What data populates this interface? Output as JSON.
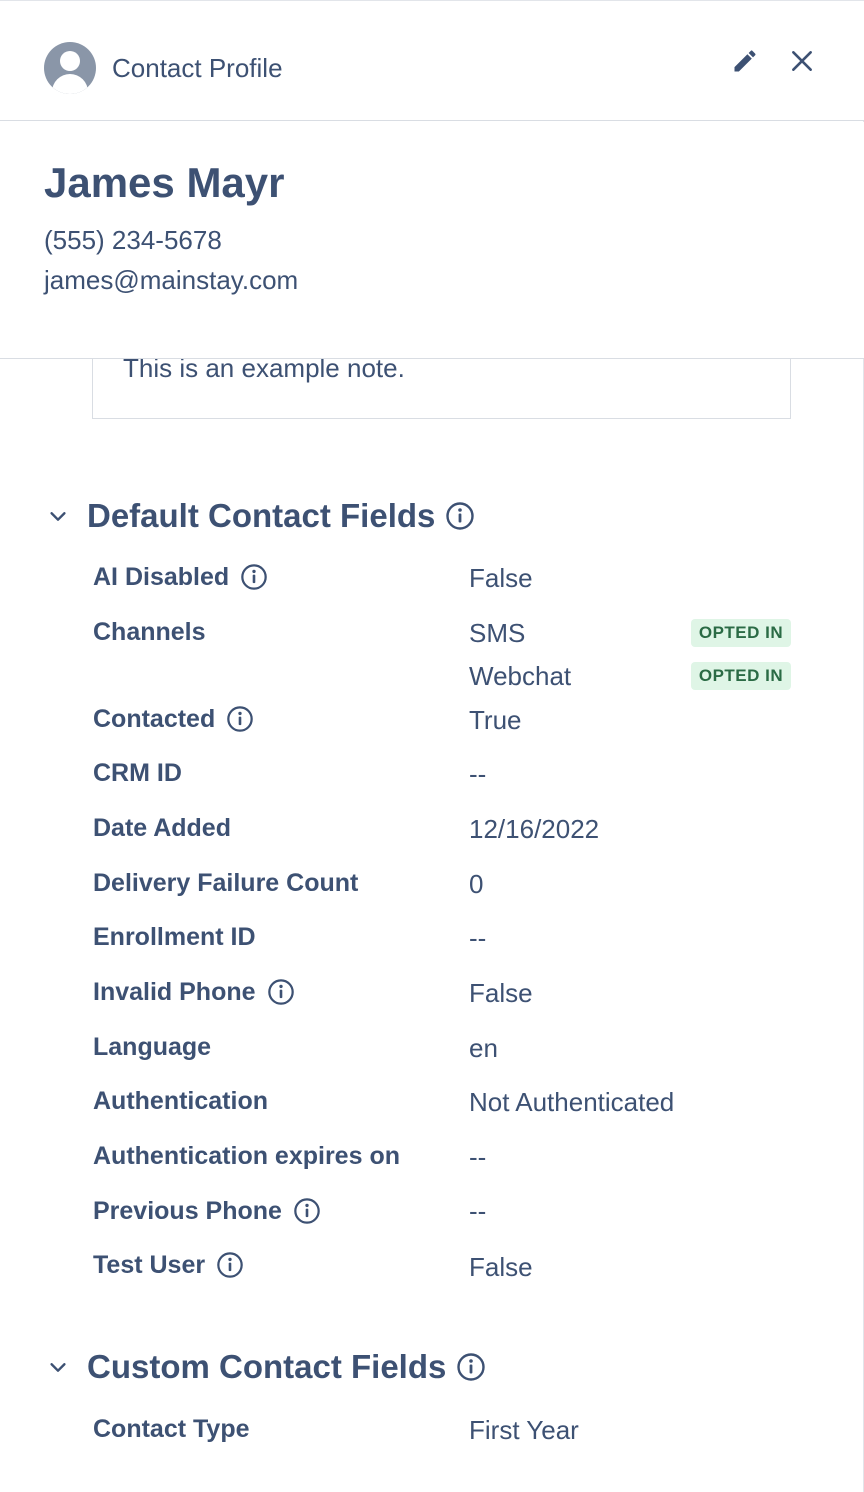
{
  "header": {
    "title": "Contact Profile",
    "avatar_icon": "user-avatar-icon",
    "edit_icon": "pencil-icon",
    "close_icon": "close-icon"
  },
  "contact": {
    "name": "James Mayr",
    "phone": "(555) 234-5678",
    "email": "james@mainstay.com"
  },
  "note": {
    "text": "This is an example note."
  },
  "default_fields": {
    "title": "Default Contact Fields",
    "items": [
      {
        "label": "AI Disabled",
        "value": "False",
        "info": true
      },
      {
        "label": "Channels",
        "values": [
          {
            "value": "SMS",
            "badge": "OPTED IN"
          },
          {
            "value": "Webchat",
            "badge": "OPTED IN"
          }
        ]
      },
      {
        "label": "Contacted",
        "value": "True",
        "info": true
      },
      {
        "label": "CRM ID",
        "value": "--"
      },
      {
        "label": "Date Added",
        "value": "12/16/2022"
      },
      {
        "label": "Delivery Failure Count",
        "value": "0"
      },
      {
        "label": "Enrollment ID",
        "value": "--"
      },
      {
        "label": "Invalid Phone",
        "value": "False",
        "info": true
      },
      {
        "label": "Language",
        "value": "en"
      },
      {
        "label": "Authentication",
        "value": "Not Authenticated"
      },
      {
        "label": "Authentication expires on",
        "value": "--"
      },
      {
        "label": "Previous Phone",
        "value": "--",
        "info": true
      },
      {
        "label": "Test User",
        "value": "False",
        "info": true
      }
    ]
  },
  "custom_fields": {
    "title": "Custom Contact Fields",
    "items": [
      {
        "label": "Contact Type",
        "value": "First Year"
      }
    ]
  },
  "colors": {
    "text": "#3d5173",
    "badge_bg": "#dff5e6",
    "badge_text": "#2b6b45",
    "border": "#d9dde3"
  }
}
